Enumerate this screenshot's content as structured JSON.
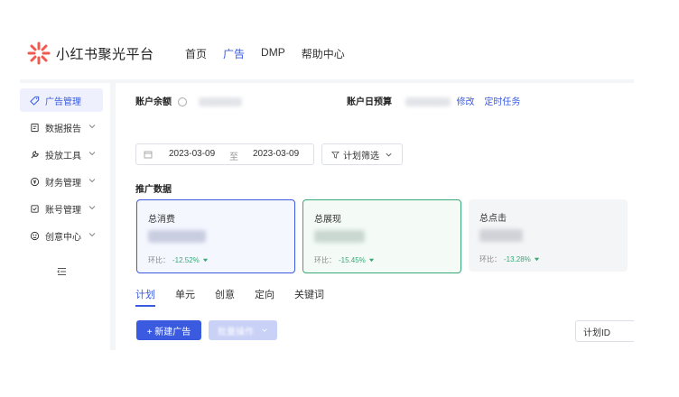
{
  "brand": {
    "name": "小红书聚光平台"
  },
  "topnav": [
    {
      "label": "首页",
      "active": false
    },
    {
      "label": "广告",
      "active": true
    },
    {
      "label": "DMP",
      "active": false
    },
    {
      "label": "帮助中心",
      "active": false
    }
  ],
  "sidebar": {
    "items": [
      {
        "label": "广告管理",
        "icon": "tag-icon",
        "active": true,
        "has_chevron": false
      },
      {
        "label": "数据报告",
        "icon": "report-icon",
        "active": false,
        "has_chevron": true
      },
      {
        "label": "投放工具",
        "icon": "tool-icon",
        "active": false,
        "has_chevron": true
      },
      {
        "label": "财务管理",
        "icon": "finance-icon",
        "active": false,
        "has_chevron": true
      },
      {
        "label": "账号管理",
        "icon": "account-icon",
        "active": false,
        "has_chevron": true
      },
      {
        "label": "创意中心",
        "icon": "creative-icon",
        "active": false,
        "has_chevron": true
      }
    ]
  },
  "account": {
    "balance_label": "账户余额",
    "daily_budget_label": "账户日预算",
    "edit_link": "修改",
    "scheduled_task_link": "定时任务"
  },
  "filters": {
    "date_start": "2023-03-09",
    "date_sep": "至",
    "date_end": "2023-03-09",
    "plan_filter_label": "计划筛选"
  },
  "promo": {
    "section_title": "推广数据",
    "cards": [
      {
        "title": "总消费",
        "compare_label": "环比：",
        "compare_value": "-12.52%",
        "selected": true,
        "border": "#3a5be0",
        "bg": "#f5f7ff"
      },
      {
        "title": "总展现",
        "compare_label": "环比：",
        "compare_value": "-15.45%",
        "selected": true,
        "border": "#3aa776",
        "bg": "#f4fbf7"
      },
      {
        "title": "总点击",
        "compare_label": "环比：",
        "compare_value": "-13.28%",
        "selected": false,
        "border": "#f4f5f7",
        "bg": "#f4f5f7"
      }
    ]
  },
  "tabs": [
    {
      "label": "计划",
      "active": true
    },
    {
      "label": "单元",
      "active": false
    },
    {
      "label": "创意",
      "active": false
    },
    {
      "label": "定向",
      "active": false
    },
    {
      "label": "关键词",
      "active": false
    }
  ],
  "actions": {
    "new_ad": "+ 新建广告",
    "batch_ops": "批量操作",
    "plan_id_select": "计划ID"
  },
  "colors": {
    "accent": "#3a5be0",
    "positive": "#3aa776",
    "logo": "#ef5b4f"
  }
}
